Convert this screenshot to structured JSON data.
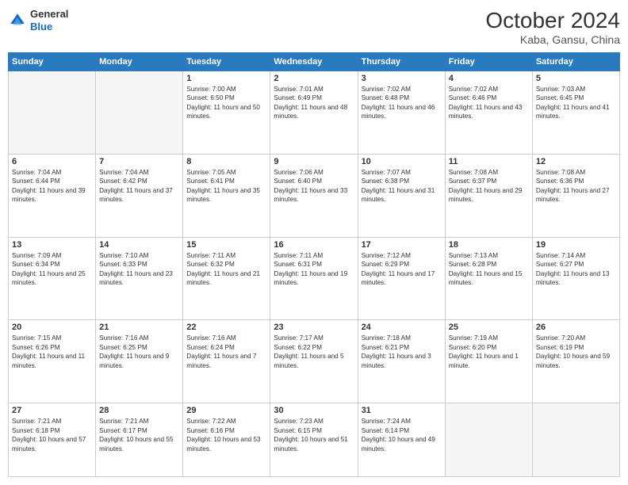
{
  "logo": {
    "general": "General",
    "blue": "Blue"
  },
  "header": {
    "month": "October 2024",
    "location": "Kaba, Gansu, China"
  },
  "weekdays": [
    "Sunday",
    "Monday",
    "Tuesday",
    "Wednesday",
    "Thursday",
    "Friday",
    "Saturday"
  ],
  "weeks": [
    [
      {
        "day": "",
        "empty": true
      },
      {
        "day": "",
        "empty": true
      },
      {
        "day": "1",
        "sunrise": "7:00 AM",
        "sunset": "6:50 PM",
        "daylight": "11 hours and 50 minutes."
      },
      {
        "day": "2",
        "sunrise": "7:01 AM",
        "sunset": "6:49 PM",
        "daylight": "11 hours and 48 minutes."
      },
      {
        "day": "3",
        "sunrise": "7:02 AM",
        "sunset": "6:48 PM",
        "daylight": "11 hours and 46 minutes."
      },
      {
        "day": "4",
        "sunrise": "7:02 AM",
        "sunset": "6:46 PM",
        "daylight": "11 hours and 43 minutes."
      },
      {
        "day": "5",
        "sunrise": "7:03 AM",
        "sunset": "6:45 PM",
        "daylight": "11 hours and 41 minutes."
      }
    ],
    [
      {
        "day": "6",
        "sunrise": "7:04 AM",
        "sunset": "6:44 PM",
        "daylight": "11 hours and 39 minutes."
      },
      {
        "day": "7",
        "sunrise": "7:04 AM",
        "sunset": "6:42 PM",
        "daylight": "11 hours and 37 minutes."
      },
      {
        "day": "8",
        "sunrise": "7:05 AM",
        "sunset": "6:41 PM",
        "daylight": "11 hours and 35 minutes."
      },
      {
        "day": "9",
        "sunrise": "7:06 AM",
        "sunset": "6:40 PM",
        "daylight": "11 hours and 33 minutes."
      },
      {
        "day": "10",
        "sunrise": "7:07 AM",
        "sunset": "6:38 PM",
        "daylight": "11 hours and 31 minutes."
      },
      {
        "day": "11",
        "sunrise": "7:08 AM",
        "sunset": "6:37 PM",
        "daylight": "11 hours and 29 minutes."
      },
      {
        "day": "12",
        "sunrise": "7:08 AM",
        "sunset": "6:36 PM",
        "daylight": "11 hours and 27 minutes."
      }
    ],
    [
      {
        "day": "13",
        "sunrise": "7:09 AM",
        "sunset": "6:34 PM",
        "daylight": "11 hours and 25 minutes."
      },
      {
        "day": "14",
        "sunrise": "7:10 AM",
        "sunset": "6:33 PM",
        "daylight": "11 hours and 23 minutes."
      },
      {
        "day": "15",
        "sunrise": "7:11 AM",
        "sunset": "6:32 PM",
        "daylight": "11 hours and 21 minutes."
      },
      {
        "day": "16",
        "sunrise": "7:11 AM",
        "sunset": "6:31 PM",
        "daylight": "11 hours and 19 minutes."
      },
      {
        "day": "17",
        "sunrise": "7:12 AM",
        "sunset": "6:29 PM",
        "daylight": "11 hours and 17 minutes."
      },
      {
        "day": "18",
        "sunrise": "7:13 AM",
        "sunset": "6:28 PM",
        "daylight": "11 hours and 15 minutes."
      },
      {
        "day": "19",
        "sunrise": "7:14 AM",
        "sunset": "6:27 PM",
        "daylight": "11 hours and 13 minutes."
      }
    ],
    [
      {
        "day": "20",
        "sunrise": "7:15 AM",
        "sunset": "6:26 PM",
        "daylight": "11 hours and 11 minutes."
      },
      {
        "day": "21",
        "sunrise": "7:16 AM",
        "sunset": "6:25 PM",
        "daylight": "11 hours and 9 minutes."
      },
      {
        "day": "22",
        "sunrise": "7:16 AM",
        "sunset": "6:24 PM",
        "daylight": "11 hours and 7 minutes."
      },
      {
        "day": "23",
        "sunrise": "7:17 AM",
        "sunset": "6:22 PM",
        "daylight": "11 hours and 5 minutes."
      },
      {
        "day": "24",
        "sunrise": "7:18 AM",
        "sunset": "6:21 PM",
        "daylight": "11 hours and 3 minutes."
      },
      {
        "day": "25",
        "sunrise": "7:19 AM",
        "sunset": "6:20 PM",
        "daylight": "11 hours and 1 minute."
      },
      {
        "day": "26",
        "sunrise": "7:20 AM",
        "sunset": "6:19 PM",
        "daylight": "10 hours and 59 minutes."
      }
    ],
    [
      {
        "day": "27",
        "sunrise": "7:21 AM",
        "sunset": "6:18 PM",
        "daylight": "10 hours and 57 minutes."
      },
      {
        "day": "28",
        "sunrise": "7:21 AM",
        "sunset": "6:17 PM",
        "daylight": "10 hours and 55 minutes."
      },
      {
        "day": "29",
        "sunrise": "7:22 AM",
        "sunset": "6:16 PM",
        "daylight": "10 hours and 53 minutes."
      },
      {
        "day": "30",
        "sunrise": "7:23 AM",
        "sunset": "6:15 PM",
        "daylight": "10 hours and 51 minutes."
      },
      {
        "day": "31",
        "sunrise": "7:24 AM",
        "sunset": "6:14 PM",
        "daylight": "10 hours and 49 minutes."
      },
      {
        "day": "",
        "empty": true
      },
      {
        "day": "",
        "empty": true
      }
    ]
  ]
}
